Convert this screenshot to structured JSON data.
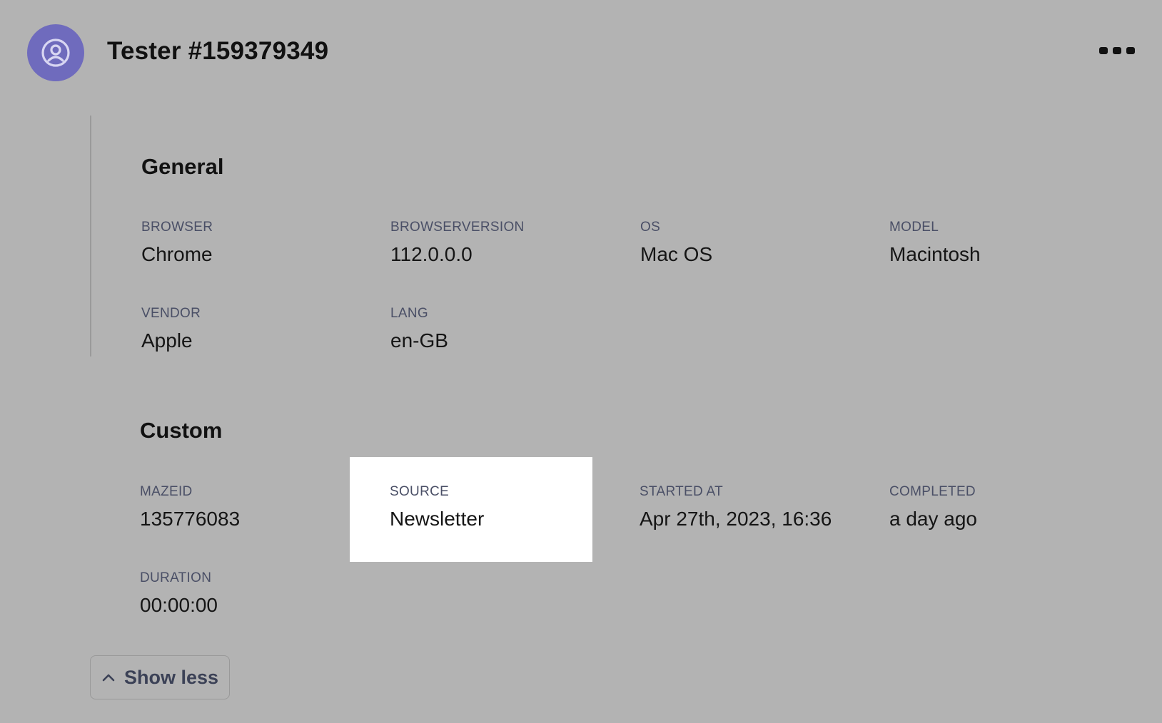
{
  "header": {
    "title": "Tester #159379349",
    "avatar_icon": "user-circle-icon",
    "avatar_color": "#6f6bbd",
    "more_icon": "more-horizontal-icon"
  },
  "general": {
    "title": "General",
    "fields": [
      {
        "label": "BROWSER",
        "value": "Chrome"
      },
      {
        "label": "BROWSERVERSION",
        "value": "112.0.0.0"
      },
      {
        "label": "OS",
        "value": "Mac OS"
      },
      {
        "label": "MODEL",
        "value": "Macintosh"
      },
      {
        "label": "VENDOR",
        "value": "Apple"
      },
      {
        "label": "LANG",
        "value": "en-GB"
      }
    ]
  },
  "custom": {
    "title": "Custom",
    "fields": [
      {
        "label": "MAZEID",
        "value": "135776083"
      },
      {
        "label": "SOURCE",
        "value": "Newsletter"
      },
      {
        "label": "STARTED AT",
        "value": "Apr 27th, 2023, 16:36"
      },
      {
        "label": "COMPLETED",
        "value": "a day ago"
      },
      {
        "label": "DURATION",
        "value": "00:00:00"
      }
    ]
  },
  "footer": {
    "show_less_label": "Show less",
    "show_less_icon": "chevron-up-icon"
  }
}
